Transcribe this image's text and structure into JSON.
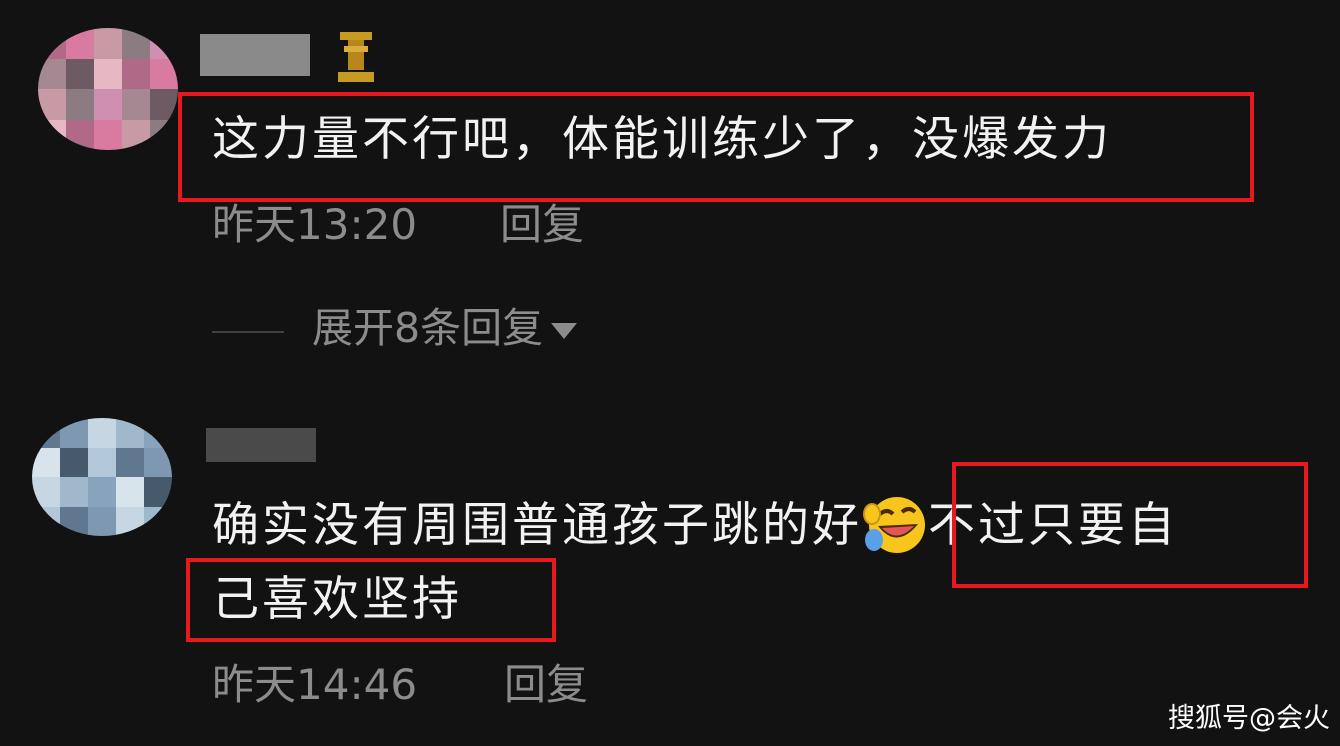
{
  "comments": [
    {
      "username": "",
      "text": "这力量不行吧，体能训练少了，没爆发力",
      "time": "昨天13:20",
      "reply_label": "回复",
      "expand_label": "展开8条回复"
    },
    {
      "username": "",
      "text_line1_part1": "确实没有周围普通孩子跳的好",
      "emoji": "rolling-on-floor-laughing-emoji",
      "text_line1_part2": "不过只要自",
      "text_line2": "己喜欢坚持",
      "time": "昨天14:46",
      "reply_label": "回复"
    }
  ],
  "watermark": "搜狐号@会火",
  "colors": {
    "background": "#121212",
    "text": "#f2f2f2",
    "meta": "#8c8c8c",
    "highlight": "#e8191e"
  }
}
